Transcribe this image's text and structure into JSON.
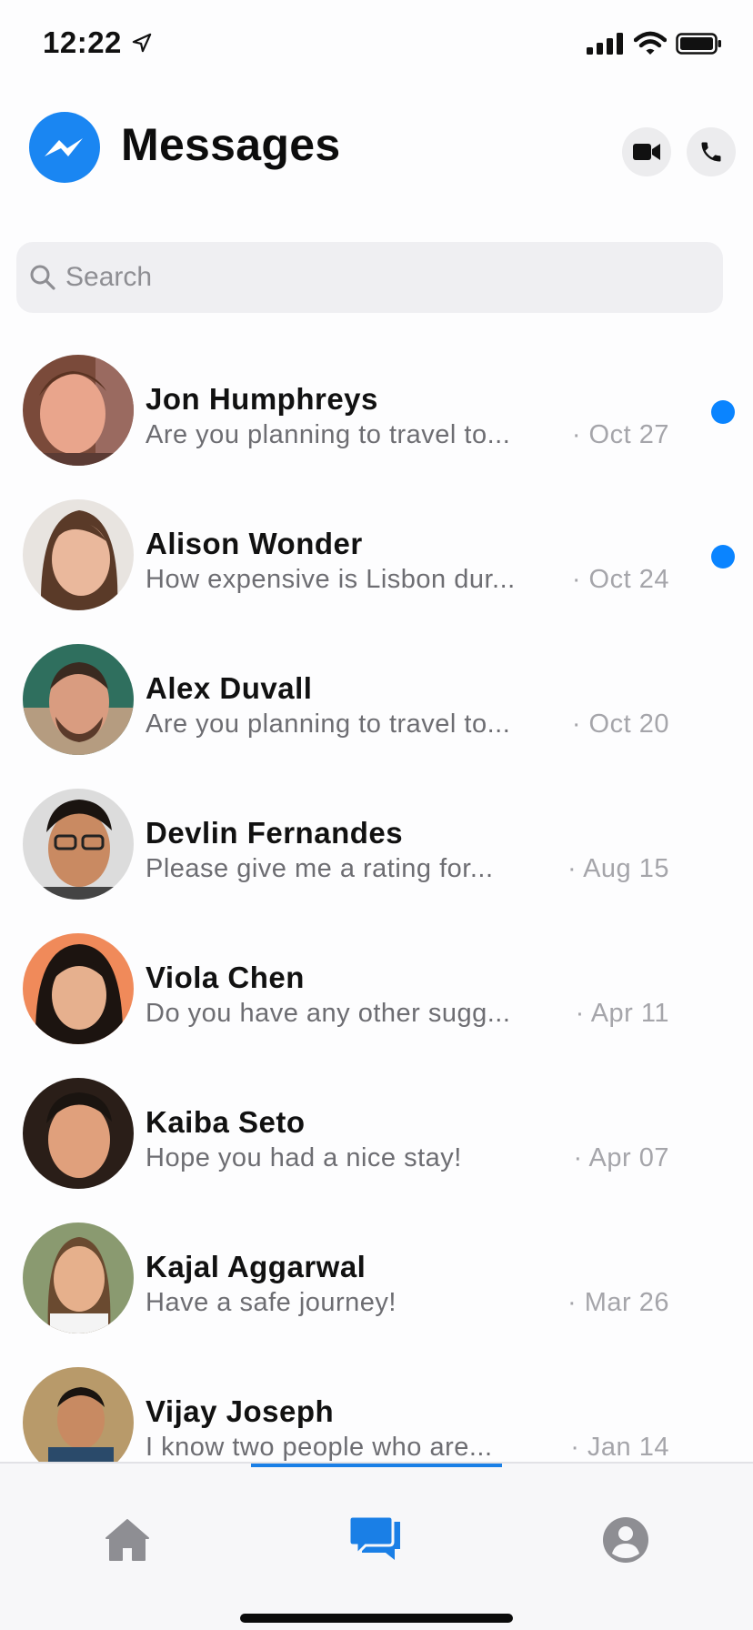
{
  "status_bar": {
    "time": "12:22"
  },
  "header": {
    "title": "Messages"
  },
  "search": {
    "placeholder": "Search",
    "value": ""
  },
  "colors": {
    "accent": "#0a84ff",
    "unread_dot": "#0a84ff",
    "tab_active": "#1a7fe6",
    "tab_inactive": "#8e8e93"
  },
  "conversations": [
    {
      "name": "Jon Humphreys",
      "preview": "Are you planning to travel to...",
      "date": "· Oct 27",
      "unread": true
    },
    {
      "name": "Alison Wonder",
      "preview": "How expensive is Lisbon dur...",
      "date": "· Oct 24",
      "unread": true
    },
    {
      "name": "Alex Duvall",
      "preview": "Are you planning to travel to...",
      "date": "· Oct 20",
      "unread": false
    },
    {
      "name": "Devlin Fernandes",
      "preview": "Please give me a rating for...",
      "date": "· Aug 15",
      "unread": false
    },
    {
      "name": "Viola Chen",
      "preview": "Do you have any other sugg...",
      "date": "· Apr 11",
      "unread": false
    },
    {
      "name": "Kaiba Seto",
      "preview": "Hope you had a nice stay!",
      "date": "· Apr 07",
      "unread": false
    },
    {
      "name": "Kajal Aggarwal",
      "preview": "Have a safe journey!",
      "date": "· Mar 26",
      "unread": false
    },
    {
      "name": "Vijay Joseph",
      "preview": "I know two people who are...",
      "date": "· Jan 14",
      "unread": false
    }
  ],
  "tabs": [
    {
      "icon": "home-icon",
      "active": false
    },
    {
      "icon": "chats-icon",
      "active": true
    },
    {
      "icon": "profile-icon",
      "active": false
    }
  ]
}
